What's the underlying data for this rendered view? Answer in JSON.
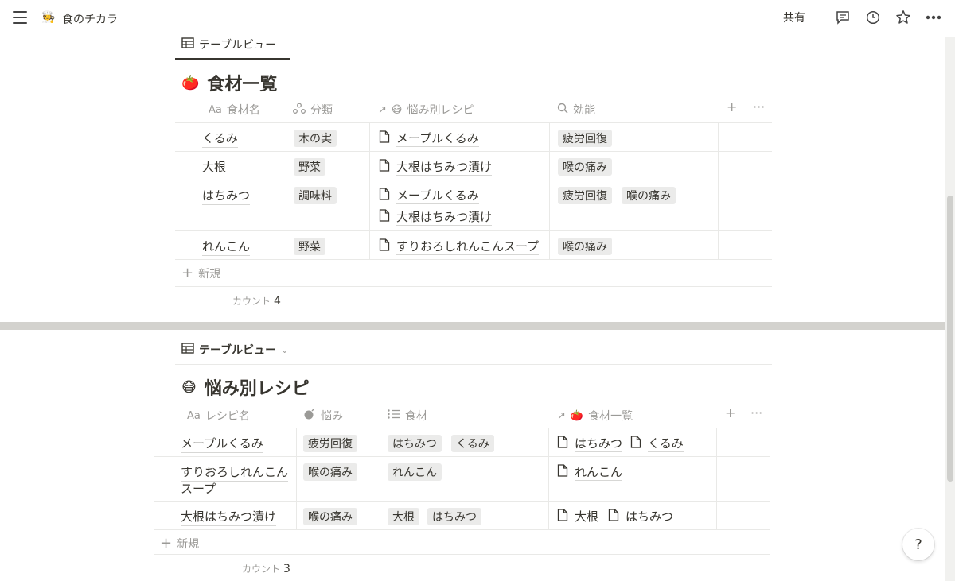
{
  "header": {
    "workspace_title": "食のチカラ",
    "share_label": "共有"
  },
  "table1": {
    "view_tab": "テーブルビュー",
    "title": "食材一覧",
    "columns": [
      "食材名",
      "分類",
      "悩み別レシピ",
      "効能"
    ],
    "column_prefix": "Aa",
    "rows": [
      {
        "name": "くるみ",
        "category": "木の実",
        "recipes": [
          "メープルくるみ"
        ],
        "effects": [
          "疲労回復"
        ]
      },
      {
        "name": "大根",
        "category": "野菜",
        "recipes": [
          "大根はちみつ漬け"
        ],
        "effects": [
          "喉の痛み"
        ]
      },
      {
        "name": "はちみつ",
        "category": "調味料",
        "recipes": [
          "メープルくるみ",
          "大根はちみつ漬け"
        ],
        "effects": [
          "疲労回復",
          "喉の痛み"
        ]
      },
      {
        "name": "れんこん",
        "category": "野菜",
        "recipes": [
          "すりおろしれんこんスープ"
        ],
        "effects": [
          "喉の痛み"
        ]
      }
    ],
    "new_label": "新規",
    "count_label": "カウント",
    "count_value": "4"
  },
  "table2": {
    "view_tab": "テーブルビュー",
    "title": "悩み別レシピ",
    "columns": [
      "レシピ名",
      "悩み",
      "食材",
      "食材一覧"
    ],
    "column_prefix": "Aa",
    "rows": [
      {
        "name_lines": [
          "メープルくるみ"
        ],
        "concern": "疲労回復",
        "ingredients": [
          "はちみつ",
          "くるみ"
        ],
        "links": [
          "はちみつ",
          "くるみ"
        ]
      },
      {
        "name_lines": [
          "すりおろしれんこん",
          "スープ"
        ],
        "concern": "喉の痛み",
        "ingredients": [
          "れんこん"
        ],
        "links": [
          "れんこん"
        ]
      },
      {
        "name_lines": [
          "大根はちみつ漬け"
        ],
        "concern": "喉の痛み",
        "ingredients": [
          "大根",
          "はちみつ"
        ],
        "links": [
          "大根",
          "はちみつ"
        ]
      }
    ],
    "new_label": "新規",
    "count_label": "カウント",
    "count_value": "3"
  },
  "help_label": "?",
  "icons": {
    "menu": "hamburger-icon",
    "comments": "comment-icon",
    "updates": "clock-icon",
    "favorite": "star-icon",
    "more": "more-horizontal-icon",
    "table": "table-icon",
    "page": "page-icon",
    "add_property": "plus-icon"
  }
}
